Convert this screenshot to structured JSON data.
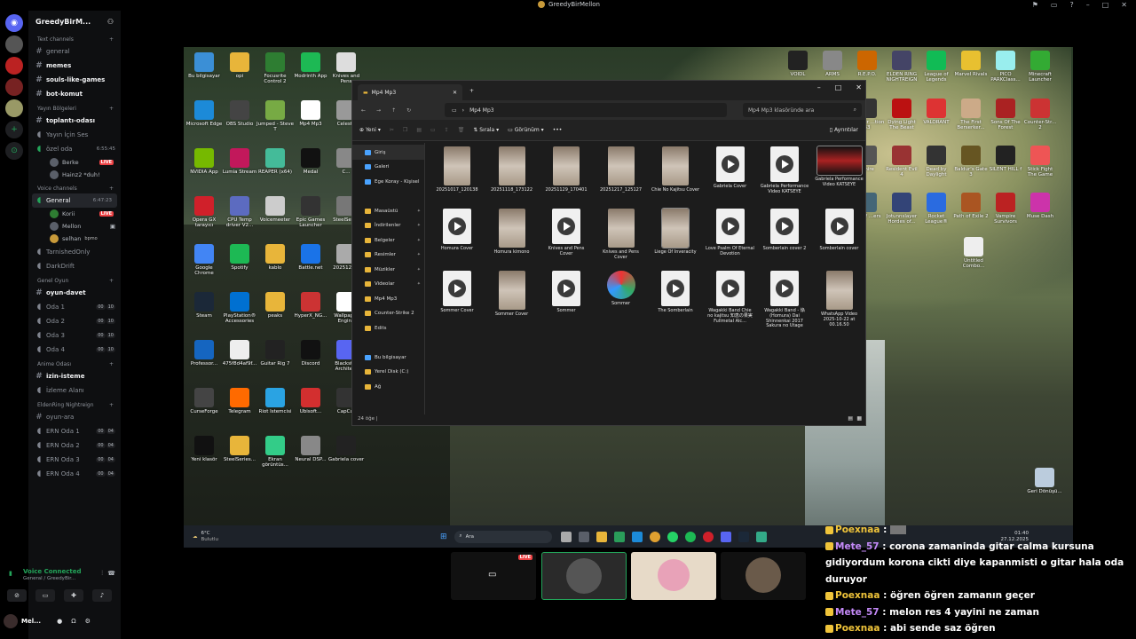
{
  "window": {
    "title": "GreedyBirMellon"
  },
  "server": {
    "name": "GreedyBirM...",
    "chevron": "v"
  },
  "categories": {
    "text": "Text channels",
    "yayin": "Yayın Bölgeleri",
    "voice": "Voice channels",
    "genel_oyun": "Genel Oyun",
    "anime": "Anime Odası",
    "elden": "EldenRing Nightreign"
  },
  "text_channels": [
    "general",
    "memes",
    "souls-like-games",
    "bot-komut"
  ],
  "yayin_channels": {
    "c1": "toplantı-odası",
    "c2": "Yayın İçin Ses",
    "c3": "özel oda",
    "c3_time": "6:55:45",
    "u1": "Berke",
    "u2": "Hainz2 *duh!"
  },
  "voice": {
    "general": "General",
    "general_time": "6:47:23",
    "u1": "Korii",
    "u2": "Mellon",
    "u3": "selhan",
    "u3_tag": "bpmo",
    "c2": "TarnishedOnly",
    "c3": "DarkDrift"
  },
  "genel_oyun": {
    "c1": "oyun-davet",
    "c2": "Oda 1",
    "c3": "Oda 2",
    "c4": "Oda 3",
    "c5": "Oda 4"
  },
  "anime": {
    "c1": "izin-isteme",
    "c2": "İzleme Alanı"
  },
  "elden": {
    "c1": "oyun-ara",
    "c2": "ERN Oda 1",
    "c3": "ERN Oda 2",
    "c4": "ERN Oda 3",
    "c5": "ERN Oda 4",
    "c6": "ERN Oda 5"
  },
  "badges": {
    "b00": "00",
    "b10": "10",
    "b04": "04",
    "live": "LIVE"
  },
  "voice_connected": {
    "status": "Voice Connected",
    "channel": "General / GreedyBir..."
  },
  "user": {
    "name": "Mel..."
  },
  "explorer": {
    "tab": "Mp4 Mp3",
    "path": "Mp4 Mp3",
    "search_placeholder": "Mp4 Mp3 klasöründe ara",
    "new": "Yeni",
    "sort": "Sırala",
    "view": "Görünüm",
    "details": "Ayrıntılar",
    "status": "24 öğe",
    "nav": [
      "Giriş",
      "Galeri",
      "Ege Koray - Kişisel",
      "Masaüstü",
      "İndirilenler",
      "Belgeler",
      "Resimler",
      "Müzikler",
      "Videolar",
      "Mp4 Mp3",
      "Counter-Strike 2",
      "Edits",
      "Bu bilgisayar",
      "Yerel Disk (C:)",
      "Ağ"
    ],
    "files": [
      "20251017_120138",
      "20251118_173122",
      "20251129_170401",
      "20251217_125127",
      "Chie No Kajitsu Cover",
      "Gabriela Cover",
      "Gabriela Performance Video KATSEYE",
      "Gabriela Performance Video KATSEYE",
      "Homura Cover",
      "Homura kimono",
      "Knives and Pens Cover",
      "Knives and Pens Cover",
      "Liege Of Inveracity",
      "Love Psalm Of Eternal Devotion",
      "Somberlain cover 2",
      "Somberlain cover",
      "Sommer Cover",
      "Sommer Cover",
      "Sommer",
      "Sommer",
      "The Somberlain",
      "Wagakki Band Chie no kajitsu 知恵の果実 Fullmetal Alc...",
      "Wagakki Band - 焔 (Homura) Dai Shinnenkai 2017 Sakura no Utage",
      "WhatsApp Video 2025-10-22 at 00.16.50"
    ]
  },
  "desktop_left": [
    "Bu bilgisayar",
    "opi",
    "Focusrite Control 2",
    "Modrinth App",
    "Knives and Pens",
    "Microsoft Edge",
    "OBS Studio",
    "Jumped - Steve T",
    "Mp4 Mp3",
    "Celeste",
    "NVIDIA App",
    "Lumia Stream",
    "REAPER (x64)",
    "Medal",
    "C...",
    "Opera GX tarayıcı",
    "CPU Temp driver V2...",
    "Voicemeeter",
    "Epic Games Launcher",
    "SteelSeri...",
    "Google Chrome",
    "Spotify",
    "kablo",
    "Battle.net",
    "2025122...",
    "Steam",
    "PlayStation® Accessories",
    "peaks",
    "HyperX_NG...",
    "Wallpaper Engine",
    "Professor...",
    "475f8d4af9f...",
    "Guitar Rig 7",
    "Discord",
    "Blackstar Architect",
    "CurseForge",
    "Telegram",
    "Riot Istemcisi",
    "Ubisoft...",
    "CapCut",
    "Yeni klasör",
    "SteelSeries...",
    "Ekran görüntüs...",
    "Neural DSP...",
    "Gabriela cover"
  ],
  "desktop_right": [
    "VOIDL",
    "ARMS",
    "R.E.P.O.",
    "ELDEN RING NIGHTREIGN",
    "League of Legends",
    "Marvel Rivals",
    "PICO PARKClass...",
    "Minecraft Launcher",
    "...Oscur ...tion 33",
    "Dying Light The Beast",
    "VALORANT",
    "The First Berserker...",
    "Sons Of The Forest",
    "Counter-Str... 2",
    "...hire",
    "Resident Evil 4",
    "Dead by Daylight",
    "Baldur's Gate 3",
    "SILENT HILL f",
    "Stick Fight The Game",
    "...e of ...ers",
    "Jotunnslayer Hordes of...",
    "Rocket League®",
    "Path of Exile 2",
    "Vampire Survivors",
    "Muse Dash",
    "Untitled Combo...",
    "Geri Dönüşü..."
  ],
  "taskbar": {
    "weather_temp": "6°C",
    "weather_text": "Bulutlu",
    "search": "Ara",
    "time": "01:40",
    "date": "27.12.2025"
  },
  "chat": [
    {
      "name": "Poexnaa",
      "msg": ""
    },
    {
      "name": "Mete_57",
      "msg": "corona zamaninda gitar calma kursuna gidiyordum korona cikti diye kapanmisti o gitar hala oda duruyor"
    },
    {
      "name": "Poexnaa",
      "msg": "öğren öğren zamanın geçer"
    },
    {
      "name": "Mete_57",
      "msg": "melon res 4 yayini ne zaman"
    },
    {
      "name": "Poexnaa",
      "msg": "abi sende saz öğren"
    }
  ]
}
